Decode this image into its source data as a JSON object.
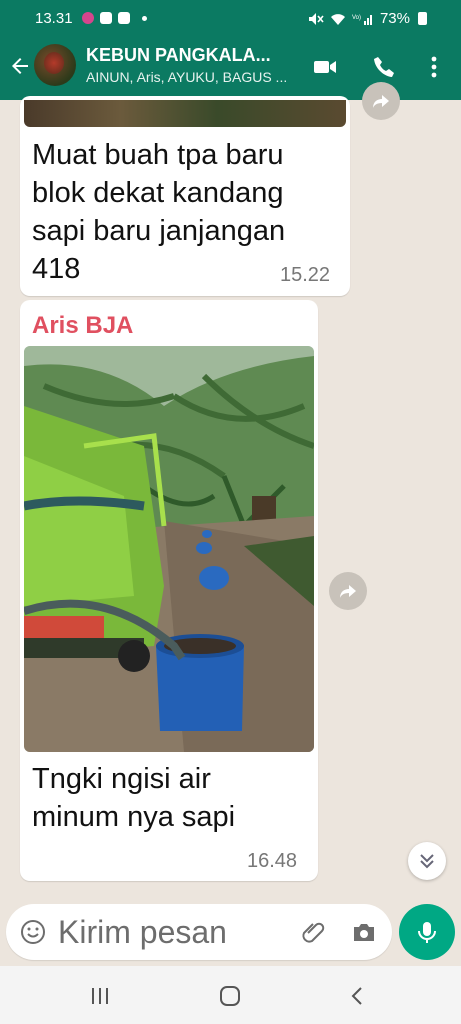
{
  "status_bar": {
    "time": "13.31",
    "battery": "73%"
  },
  "header": {
    "title": "KEBUN PANGKALA...",
    "subtitle": "AINUN, Aris, AYUKU, BAGUS ..."
  },
  "messages": [
    {
      "text_lines": [
        "Muat buah tpa baru",
        "blok dekat kandang",
        "sapi baru janjangan",
        "418"
      ],
      "time": "15.22"
    },
    {
      "sender": "Aris BJA",
      "text_lines": [
        "Tngki ngisi air",
        "minum nya sapi"
      ],
      "time": "16.48"
    }
  ],
  "input": {
    "placeholder": "Kirim pesan"
  },
  "icons": {
    "back": "arrow-left-icon",
    "video": "video-call-icon",
    "call": "phone-icon",
    "menu": "more-vert-icon",
    "forward": "forward-icon",
    "scroll": "chevron-double-down-icon",
    "emoji": "emoji-icon",
    "attach": "paperclip-icon",
    "camera": "camera-icon",
    "mic": "mic-icon"
  },
  "colors": {
    "header": "#0b7a62",
    "sender": "#e05060",
    "mic": "#00a884",
    "chat_bg": "#ece5dd"
  }
}
